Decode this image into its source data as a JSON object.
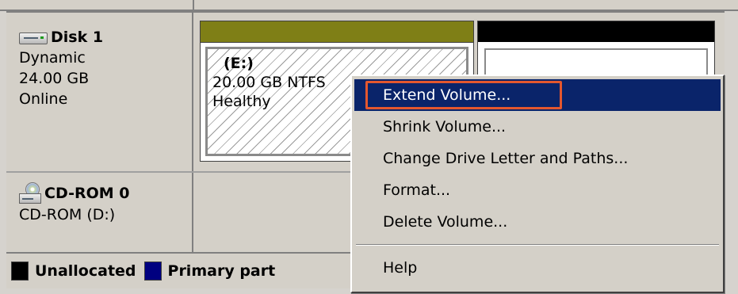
{
  "disks": [
    {
      "name": "Disk 1",
      "type": "Dynamic",
      "size": "24.00 GB",
      "status": "Online",
      "icon": "hard-disk-icon",
      "volumes": [
        {
          "drive": "(E:)",
          "size_fs": "20.00 GB NTFS",
          "health": "Healthy",
          "bar_color": "#7f7f16"
        },
        {
          "drive": "",
          "bar_color": "#000000"
        }
      ]
    },
    {
      "name": "CD-ROM 0",
      "type": "CD-ROM (D:)",
      "icon": "cdrom-drive-icon"
    }
  ],
  "legend": [
    {
      "label": "Unallocated",
      "color": "#000000"
    },
    {
      "label": "Primary part",
      "color": "#000080"
    }
  ],
  "context_menu": {
    "items": [
      {
        "label": "Extend Volume...",
        "highlighted": true
      },
      {
        "label": "Shrink Volume..."
      },
      {
        "label": "Change Drive Letter and Paths..."
      },
      {
        "label": "Format..."
      },
      {
        "label": "Delete Volume..."
      }
    ],
    "help_label": "Help"
  },
  "colors": {
    "selection": "#0a246a",
    "focus_outline": "#e4572e",
    "panel": "#d4d0c8"
  }
}
